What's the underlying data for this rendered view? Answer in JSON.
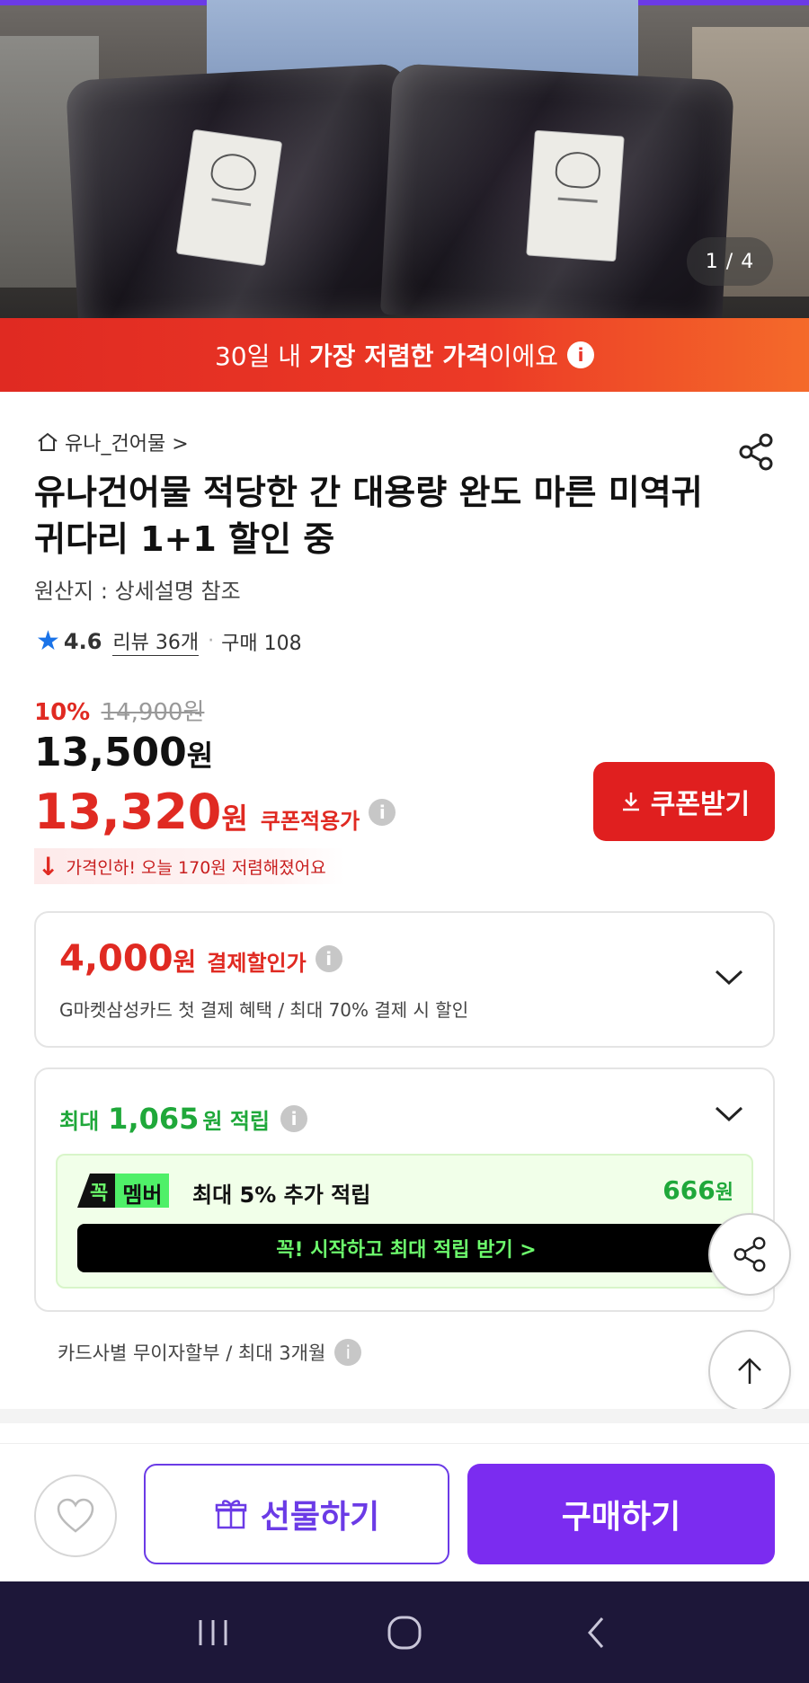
{
  "hero": {
    "counter": "1 / 4"
  },
  "promo": {
    "prefix": "30일 내 ",
    "highlight": "가장 저렴한 가격",
    "suffix": "이에요",
    "info_glyph": "i"
  },
  "product": {
    "seller": "유나_건어물 >",
    "title": "유나건어물 적당한 간 대용량 완도 마른 미역귀 귀다리 1+1 할인 중",
    "origin": "원산지 : 상세설명 참조",
    "rating": "4.6",
    "reviews": "리뷰 36개",
    "purchases": "구매 108",
    "discount_pct": "10%",
    "original_price": "14,900원",
    "price_num": "13,500",
    "price_unit": "원",
    "coupon_price_num": "13,320",
    "coupon_price_unit": "원",
    "coupon_label": "쿠폰적용가",
    "coupon_button": "쿠폰받기",
    "drop_note": "가격인하! 오늘 170원 저렴해졌어요"
  },
  "payment": {
    "amount_num": "4,000",
    "amount_unit": "원",
    "label": "결제할인가",
    "sub": "G마켓삼성카드 첫 결제 혜택 / 최대 70% 결제 시 할인"
  },
  "points": {
    "prefix": "최대",
    "amount_num": "1,065",
    "suffix": "원 적립",
    "member_badge_k": "꼭",
    "member_badge_m": "멤버",
    "member_desc": "최대 5% 추가 적립",
    "member_amount_num": "666",
    "member_amount_unit": "원",
    "start_button": "꼭! 시작하고 최대 적립 받기 >"
  },
  "installment": "카드사별 무이자할부 / 최대 3개월",
  "actions": {
    "gift": "선물하기",
    "buy": "구매하기"
  },
  "colors": {
    "brand_purple": "#7b2cf0",
    "sale_red": "#e02a22",
    "points_green": "#1fa83a",
    "member_green": "#4ff068"
  },
  "icons": [
    "home-icon",
    "share-icon",
    "star-icon",
    "info-icon",
    "download-icon",
    "chevron-down-icon",
    "arrow-up-icon",
    "heart-icon",
    "gift-icon",
    "recent-apps-icon",
    "home-nav-icon",
    "back-icon"
  ]
}
